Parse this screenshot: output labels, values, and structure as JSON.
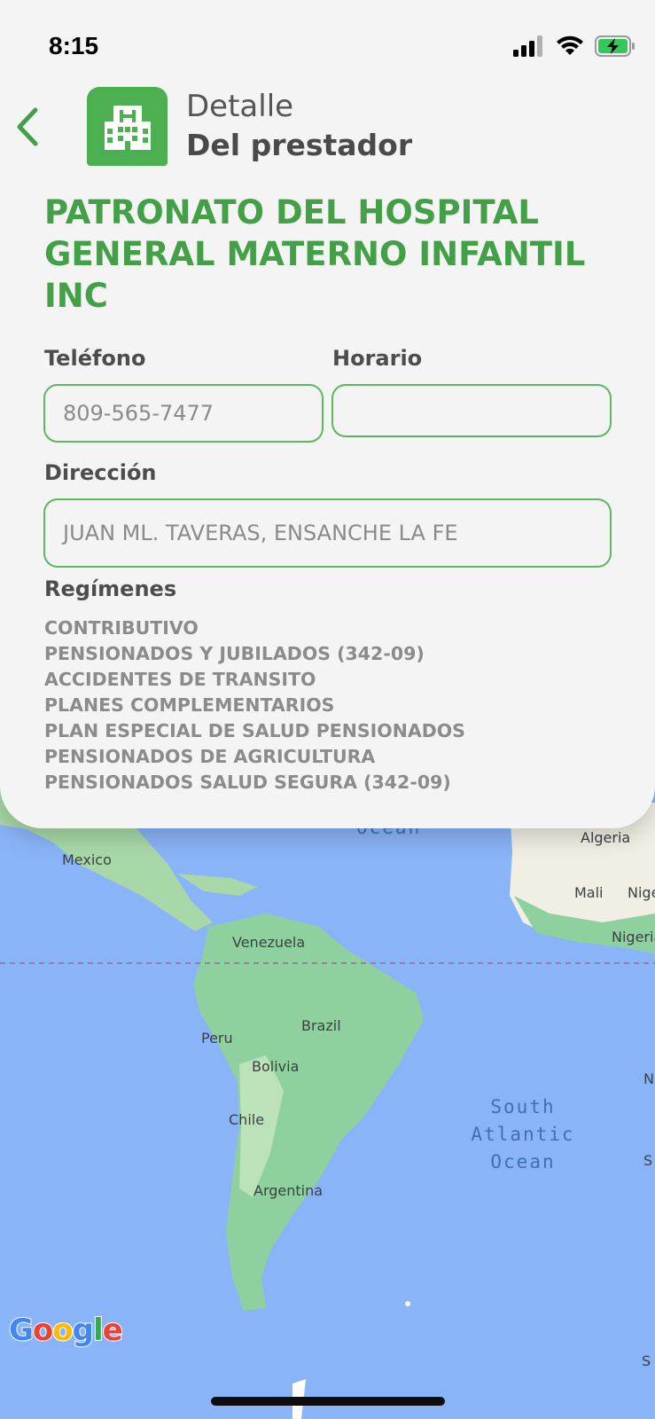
{
  "status_bar": {
    "time": "8:15"
  },
  "header": {
    "line1": "Detalle",
    "line2": "Del prestador"
  },
  "provider": {
    "name": "PATRONATO DEL HOSPITAL GENERAL MATERNO INFANTIL INC",
    "phone_label": "Teléfono",
    "phone_value": "809-565-7477",
    "schedule_label": "Horario",
    "schedule_value": "",
    "address_label": "Dirección",
    "address_value": "JUAN ML. TAVERAS, ENSANCHE LA FE",
    "regimes_label": "Regímenes",
    "regimes": [
      "CONTRIBUTIVO",
      "PENSIONADOS Y JUBILADOS (342-09)",
      "ACCIDENTES DE TRANSITO",
      "PLANES COMPLEMENTARIOS",
      "PLAN ESPECIAL DE SALUD PENSIONADOS",
      "PENSIONADOS DE AGRICULTURA",
      "PENSIONADOS SALUD SEGURA (342-09)"
    ]
  },
  "map": {
    "labels": {
      "mexico": "Mexico",
      "venezuela": "Venezuela",
      "peru": "Peru",
      "brazil": "Brazil",
      "bolivia": "Bolivia",
      "chile": "Chile",
      "argentina": "Argentina",
      "algeria": "Algeria",
      "mali": "Mali",
      "niger": "Nige",
      "nigeria": "Nigeria",
      "ocean_partial": "Ocean",
      "edge_n": "N",
      "edge_s": "S",
      "edge_s2": "S"
    },
    "ocean_lines": [
      "South",
      "Atlantic",
      "Ocean"
    ],
    "google": {
      "G": "G",
      "o1": "o",
      "o2": "o",
      "g": "g",
      "l": "l",
      "e": "e"
    }
  },
  "colors": {
    "accent": "#43a047",
    "sheet_bg": "#f4f4f4",
    "ocean": "#8ab4f8",
    "land_green": "#8fd19e",
    "land_sand": "#f1efe4"
  }
}
